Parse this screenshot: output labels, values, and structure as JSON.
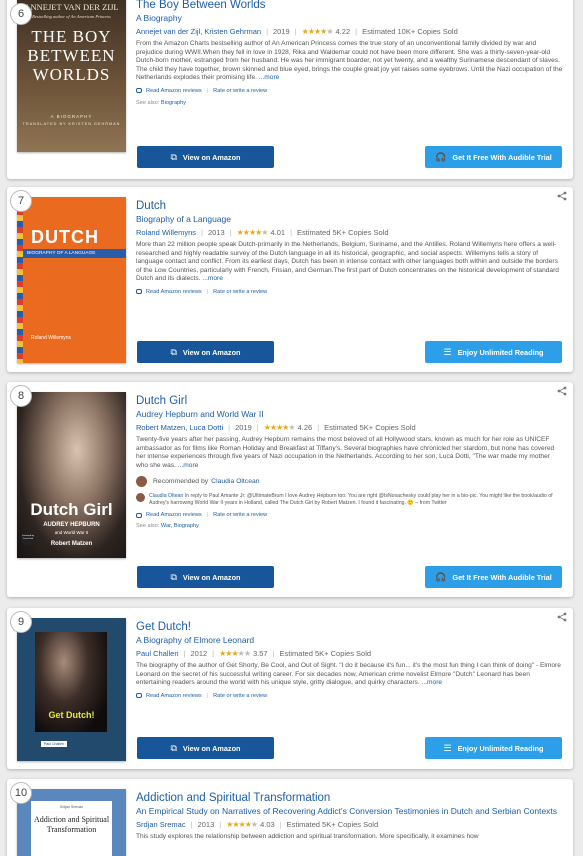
{
  "books": [
    {
      "rank": "6",
      "title": "The Boy Between Worlds",
      "subtitle": "A Biography",
      "authors": "Annejet van der Zijl, Kristen Gehrman",
      "year": "2019",
      "stars_filled": 4,
      "rating": "4.22",
      "copies": "Estimated 10K+ Copies Sold",
      "description": "From the Amazon Charts bestselling author of An American Princess comes the true story of an unconventional family divided by war and prejudice during WWII.When they fell in love in 1928, Rika and Waldemar could not have been more different. She was a thirty-seven-year-old Dutch-born mother, estranged from her husband. He was her immigrant boarder, not yet twenty, and a wealthy Surinamese descendant of slaves. The child they have together, brown skinned and blue eyed, brings the couple great joy yet raises some eyebrows. Until the Nazi occupation of the Netherlands explodes their promising life.",
      "more": "...more",
      "reviews_link": "Read Amazon reviews",
      "rate_link": "Rate or write a review",
      "see_also_label": "See also:",
      "see_also": "Biography",
      "amazon_btn": "View on Amazon",
      "right_btn": "Get It Free With Audible Trial",
      "right_icon": "headphones-icon",
      "cover": {
        "top": "ANNEJET VAN DER ZIJL",
        "blurb": "Bestselling author of An American Princess",
        "main": "THE BOY BETWEEN WORLDS",
        "sub": "A BIOGRAPHY",
        "foot": "TRANSLATED BY KRISTEN GEHRMAN"
      }
    },
    {
      "rank": "7",
      "title": "Dutch",
      "subtitle": "Biography of a Language",
      "authors": "Roland Willemyns",
      "year": "2013",
      "stars_filled": 4,
      "rating": "4.01",
      "copies": "Estimated 5K+ Copies Sold",
      "description": "More than 22 million people speak Dutch-primarily in the Netherlands, Belgium, Suriname, and the Antilles. Roland Willemyns here offers a well-researched and highly readable survey of the Dutch language in all its historical, geographic, and social aspects. Willemyns tells a story of language contact and conflict. From its earliest days, Dutch has been in intense contact with other languages both within and outside the borders of the Low Countries, particularly with French, Frisian, and German.The first part of Dutch concentrates on the historical development of standard Dutch and its dialects.",
      "more": "...more",
      "reviews_link": "Read Amazon reviews",
      "rate_link": "Rate or write a review",
      "amazon_btn": "View on Amazon",
      "right_btn": "Enjoy Unlimited Reading",
      "right_icon": "book-icon",
      "cover": {
        "main": "DUTCH",
        "sub": "BIOGRAPHY OF A LANGUAGE",
        "author": "Roland Willemyns"
      }
    },
    {
      "rank": "8",
      "title": "Dutch Girl",
      "subtitle": "Audrey Hepburn and World War II",
      "authors": "Robert Matzen, Luca Dotti",
      "year": "2019",
      "stars_filled": 4,
      "rating": "4.26",
      "copies": "Estimated 5K+ Copies Sold",
      "description": "Twenty-five years after her passing, Audrey Hepburn remains the most beloved of all Hollywood stars, known as much for her role as UNICEF ambassador as for films like Roman Holiday and Breakfast at Tiffany's. Several biographies have chronicled her stardom, but none has covered her intense experiences through five years of Nazi occupation in the Netherlands. According to her son, Luca Dotti, \"The war made my mother who she was.",
      "more": "...more",
      "recommended_label": "Recommended by",
      "recommended_by": "Claudia Oltcean",
      "tweet_name": "Claudia Oltean",
      "tweet_text": "In reply to Paul Amante Jr: @UltimateBrum I love Audrey Hepburn too. You are right @IsNosachesky could play her in a bio-pic. You might like the book/audio of Audrey's harrowing World War II years in Holland, called The Dutch Girl by Robert Matzen. I found it fascinating.",
      "tweet_source": "– from Twitter",
      "reviews_link": "Read Amazon reviews",
      "rate_link": "Rate or write a review",
      "see_also_label": "See also:",
      "see_also": "War, Biography",
      "amazon_btn": "View on Amazon",
      "right_btn": "Get It Free With Audible Trial",
      "right_icon": "headphones-icon",
      "cover": {
        "main": "Dutch Girl",
        "sub": "AUDREY HEPBURN",
        "sub2": "and World War II",
        "author": "Robert Matzen",
        "badge": "Foreword by Luca Dotti"
      }
    },
    {
      "rank": "9",
      "title": "Get Dutch!",
      "subtitle": "A Biography of Elmore Leonard",
      "authors": "Paul Challen",
      "year": "2012",
      "stars_filled": 3,
      "rating": "3.57",
      "copies": "Estimated 5K+ Copies Sold",
      "description": "The biography of the author of Get Shorty, Be Cool, and Out of Sight. \"I do it because it's fun... it's the most fun thing I can think of doing\" - Elmore Leonard on the secret of his successful writing career. For six decades now, American crime novelist Elmore \"Dutch\" Leonard has been entertaining readers around the world with his unique style, gritty dialogue, and quirky characters.",
      "more": "...more",
      "reviews_link": "Read Amazon reviews",
      "rate_link": "Rate or write a review",
      "amazon_btn": "View on Amazon",
      "right_btn": "Enjoy Unlimited Reading",
      "right_icon": "book-icon",
      "cover": {
        "main": "Get Dutch!",
        "author": "Paul Challen"
      }
    },
    {
      "rank": "10",
      "title": "Addiction and Spiritual Transformation",
      "subtitle": "An Empirical Study on Narratives of Recovering Addict's Conversion Testimonies in Dutch and Serbian Contexts",
      "authors": "Srdjan Sremac",
      "year": "2013",
      "stars_filled": 4,
      "rating": "4.03",
      "copies": "Estimated 5K+ Copies Sold",
      "description": "This study explores the relationship between addiction and spiritual transformation. More specifically, it examines how",
      "cover": {
        "author": "Srdjan Sremac",
        "main": "Addiction and Spiritual Transformation"
      }
    }
  ]
}
